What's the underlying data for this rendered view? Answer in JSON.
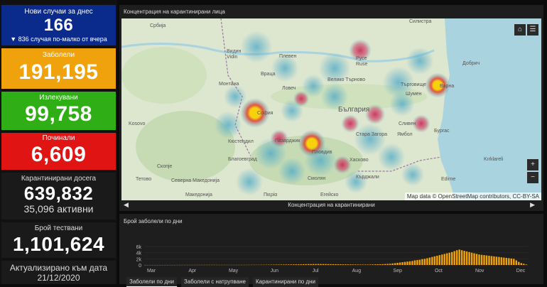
{
  "sidebar": {
    "new_cases": {
      "label": "Нови случаи за днес",
      "value": "166",
      "sub": "▼ 836 случая по-малко от вчера"
    },
    "infected": {
      "label": "Заболели",
      "value": "191,195"
    },
    "recovered": {
      "label": "Излекувани",
      "value": "99,758"
    },
    "deaths": {
      "label": "Починали",
      "value": "6,609"
    },
    "quarantined": {
      "label": "Карантинирани досега",
      "value": "639,832",
      "sub": "35,096 активни"
    },
    "tested": {
      "label": "Брой тествани",
      "value": "1,101,624"
    },
    "updated": {
      "label": "Актуализирано към дата",
      "date": "21/12/2020"
    }
  },
  "map_panel": {
    "title": "Концентрация на карантинирани лица",
    "footer": "Концентрация на карантинирани",
    "attribution": "Map data © OpenStreetMap contributors, CC-BY-SA",
    "home_icon": "home-icon",
    "list_icon": "list-icon",
    "zoom_in": "+",
    "zoom_out": "−",
    "prev": "◀",
    "next": "▶",
    "place_labels": [
      "Србија",
      "Видин",
      "Vidin",
      "Плевен",
      "Русе",
      "Ruse",
      "Силистра",
      "Враца",
      "Монтана",
      "Добрич",
      "Варна",
      "Шумен",
      "Ловеч",
      "Велико Търново",
      "Търговище",
      "България",
      "София",
      "Кюстендил",
      "Пазарджик",
      "Пловдив",
      "Стара Загора",
      "Сливен",
      "Ямбол",
      "Бургас",
      "Хасково",
      "Кърджали",
      "Смолян",
      "Благоевград",
      "Kosovo",
      "Северна Македонија",
      "Скопје",
      "Kırklareli",
      "Edirne",
      "Тетово",
      "Македонија",
      "Егейско",
      "Πιερία"
    ],
    "hotspot_colors": {
      "low": "#4aa8c9",
      "mid": "#c8325c",
      "high": "#f5d20c"
    }
  },
  "chart_panel": {
    "title": "Брой заболели по дни",
    "tabs": [
      "Заболели по дни",
      "Заболели с натрупване",
      "Карантинирани по дни"
    ],
    "active_tab": 0
  },
  "chart_data": {
    "type": "bar",
    "title": "Брой заболели по дни",
    "xlabel": "",
    "ylabel": "",
    "ylim": [
      0,
      6000
    ],
    "y_ticks": [
      "0",
      "2k",
      "4k",
      "6k"
    ],
    "x_ticks": [
      "Mar",
      "Apr",
      "May",
      "Jun",
      "Jul",
      "Aug",
      "Sep",
      "Oct",
      "Nov",
      "Dec"
    ],
    "bar_color": "#f0a20c",
    "series": [
      {
        "values": [
          0,
          0,
          1,
          2,
          3,
          3,
          4,
          5,
          6,
          8,
          10,
          12,
          15,
          18,
          20,
          22,
          25,
          25,
          28,
          30,
          32,
          35,
          35,
          38,
          40,
          40,
          42,
          45,
          45,
          40,
          38,
          40,
          42,
          38,
          36,
          35,
          34,
          30,
          32,
          35,
          40,
          42,
          45,
          50,
          55,
          60,
          60,
          65,
          70,
          80,
          90,
          100,
          110,
          120,
          130,
          140,
          150,
          160,
          170,
          180,
          190,
          200,
          210,
          220,
          240,
          260,
          270,
          280,
          290,
          300,
          310,
          300,
          290,
          280,
          270,
          260,
          250,
          240,
          230,
          220,
          210,
          200,
          190,
          180,
          170,
          160,
          150,
          140,
          130,
          130,
          140,
          160,
          180,
          200,
          220,
          240,
          260,
          300,
          350,
          400,
          500,
          600,
          700,
          800,
          900,
          1000,
          1100,
          1200,
          1300,
          1500,
          1600,
          1700,
          1900,
          2000,
          2200,
          2400,
          2600,
          2800,
          3000,
          3200,
          3400,
          3600,
          3800,
          4000,
          4200,
          4500,
          4800,
          5000,
          4800,
          4600,
          4400,
          4200,
          4000,
          3800,
          3600,
          3400,
          3300,
          3200,
          3100,
          3000,
          2900,
          2800,
          2700,
          2600,
          2500,
          2400,
          2300,
          2200,
          2100,
          2000,
          1500,
          1000,
          600,
          400,
          166
        ]
      }
    ]
  }
}
